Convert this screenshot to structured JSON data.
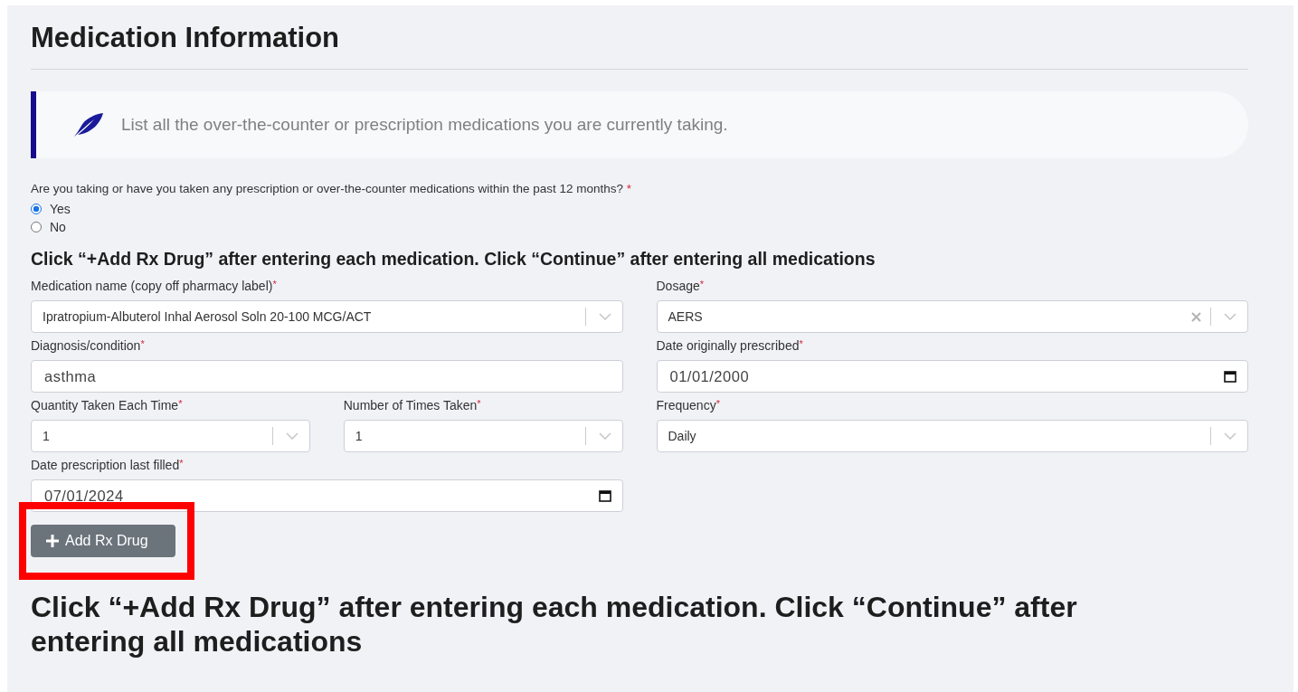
{
  "section_title": "Medication Information",
  "callout": {
    "text": "List all the over-the-counter or prescription medications you are currently taking."
  },
  "question": {
    "text": "Are you taking or have you taken any prescription or over-the-counter medications within the past 12 months?",
    "required_mark": "*",
    "options": [
      {
        "label": "Yes",
        "selected": true
      },
      {
        "label": "No",
        "selected": false
      }
    ]
  },
  "instruction": "Click “+Add Rx Drug” after entering each medication. Click “Continue” after entering all medications",
  "field_rows": [
    [
      {
        "label": "Medication name (copy off pharmacy label)",
        "required_mark": "*",
        "kind": "select",
        "value": "Ipratropium-Albuterol Inhal Aerosol Soln 20-100 MCG/ACT",
        "clearable": false
      },
      {
        "label": "Dosage",
        "required_mark": "*",
        "kind": "select",
        "value": "AERS",
        "clearable": true
      }
    ],
    [
      {
        "label": "Diagnosis/condition",
        "required_mark": "*",
        "kind": "text",
        "value": "asthma"
      },
      {
        "label": "Date originally prescribed",
        "required_mark": "*",
        "kind": "date",
        "value": "01/01/2000"
      }
    ],
    [
      {
        "label": "Quantity Taken Each Time",
        "required_mark": "*",
        "kind": "select",
        "value": "1",
        "clearable": false
      },
      {
        "label": "Number of Times Taken",
        "required_mark": "*",
        "kind": "select",
        "value": "1",
        "clearable": false
      },
      {
        "label": "Frequency",
        "required_mark": "*",
        "kind": "select",
        "value": "Daily",
        "clearable": false
      }
    ],
    [
      {
        "label": "Date prescription last filled",
        "required_mark": "*",
        "kind": "date",
        "value": "07/01/2024"
      }
    ]
  ],
  "add_button": {
    "label": "Add Rx Drug",
    "highlighted": true
  },
  "bottom_heading": "Click “+Add Rx Drug” after entering each medication. Click “Continue” after entering all medications"
}
